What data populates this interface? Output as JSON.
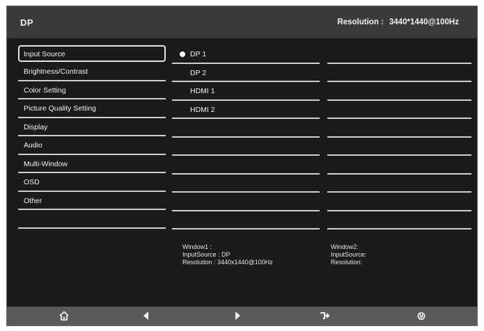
{
  "header": {
    "title": "DP",
    "resolution_label": "Resolution :",
    "resolution_value": "3440*1440@100Hz"
  },
  "menu": {
    "items": [
      {
        "label": "Input Source"
      },
      {
        "label": "Brightness/Contrast"
      },
      {
        "label": "Color Setting"
      },
      {
        "label": "Picture Quality Setting"
      },
      {
        "label": "Display"
      },
      {
        "label": "Audio"
      },
      {
        "label": "Multi-Window"
      },
      {
        "label": "OSD"
      },
      {
        "label": "Other"
      },
      {
        "label": ""
      }
    ],
    "selected_index": 0
  },
  "submenu": {
    "items": [
      {
        "label": "DP 1",
        "selected": true
      },
      {
        "label": "DP 2"
      },
      {
        "label": "HDMI 1"
      },
      {
        "label": "HDMI 2"
      },
      {
        "label": ""
      },
      {
        "label": ""
      },
      {
        "label": ""
      },
      {
        "label": ""
      },
      {
        "label": ""
      },
      {
        "label": ""
      }
    ]
  },
  "window1": {
    "title": "Window1 :",
    "input_source": "InputSource : DP",
    "resolution": "Resolution : 3440x1440@100Hz"
  },
  "window2": {
    "title": "Window2:",
    "input_source": "InputSource:",
    "resolution": "Resolution:"
  },
  "footer": {
    "buttons": [
      {
        "icon": "home-icon"
      },
      {
        "icon": "left-arrow-icon"
      },
      {
        "icon": "right-arrow-icon"
      },
      {
        "icon": "exit-icon"
      },
      {
        "icon": "power-icon"
      }
    ]
  },
  "colors": {
    "panel": "#1b1b1b",
    "header": "#3a3a3a",
    "footer": "#5a5a5a",
    "text": "#f2f2f2"
  }
}
